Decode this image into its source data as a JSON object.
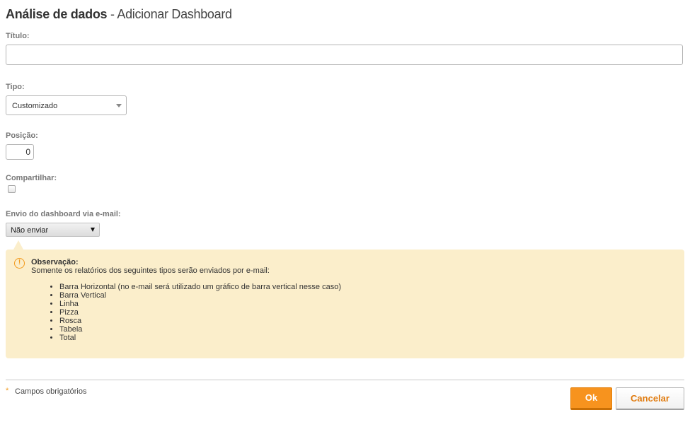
{
  "header": {
    "title": "Análise de dados",
    "separator": " - ",
    "subtitle": "Adicionar Dashboard"
  },
  "form": {
    "title_label": "Título:",
    "title_value": "",
    "type_label": "Tipo:",
    "type_value": "Customizado",
    "position_label": "Posição:",
    "position_value": "0",
    "share_label": "Compartilhar:",
    "share_checked": false,
    "email_label": "Envio do dashboard via e-mail:",
    "email_value": "Não enviar"
  },
  "note": {
    "icon": "warning-icon",
    "icon_glyph": "!",
    "title": "Observação:",
    "text": "Somente os relatórios dos seguintes tipos serão enviados por e-mail:",
    "items": [
      "Barra Horizontal (no e-mail será utilizado um gráfico de barra vertical nesse caso)",
      "Barra Vertical",
      "Linha",
      "Pizza",
      "Rosca",
      "Tabela",
      "Total"
    ]
  },
  "footer": {
    "required_marker": "*",
    "required_text": "Campos obrigatórios",
    "ok_label": "Ok",
    "cancel_label": "Cancelar"
  },
  "colors": {
    "accent": "#f7931e",
    "note_background": "#fbeecb",
    "label": "#777777"
  }
}
